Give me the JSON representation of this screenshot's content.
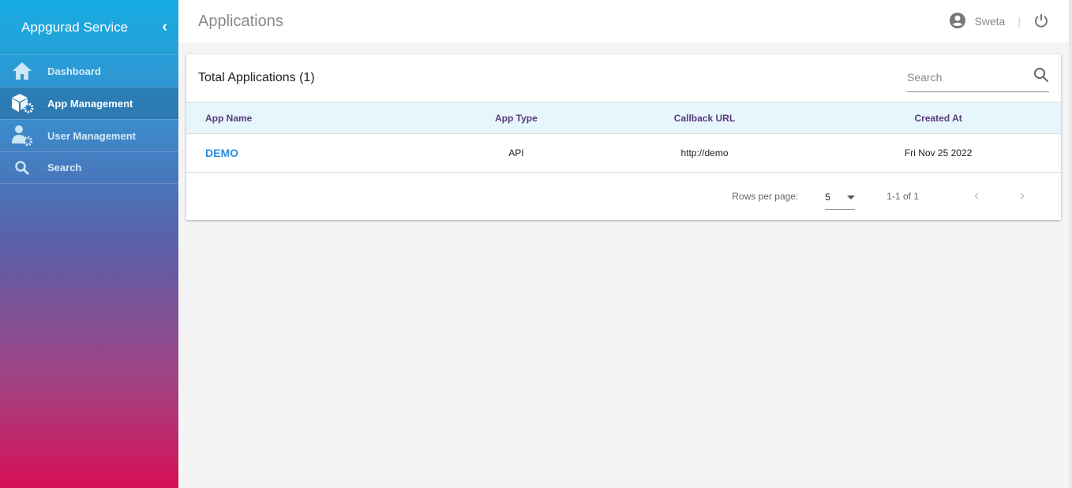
{
  "sidebar": {
    "brand": "Appgurad Service",
    "items": [
      {
        "label": "Dashboard",
        "icon": "home-icon"
      },
      {
        "label": "App Management",
        "icon": "app-settings-icon",
        "active": true
      },
      {
        "label": "User Management",
        "icon": "user-settings-icon"
      },
      {
        "label": "Search",
        "icon": "search-icon"
      }
    ]
  },
  "header": {
    "title": "Applications",
    "user": "Sweta",
    "separator": "|"
  },
  "card": {
    "title": "Total Applications",
    "count": "(1)",
    "search_placeholder": "Search",
    "columns": [
      "App Name",
      "App Type",
      "Callback URL",
      "Created At"
    ],
    "rows": [
      {
        "name": "DEMO",
        "type": "API",
        "url": "http://demo",
        "created": "Fri Nov 25 2022"
      }
    ],
    "footer": {
      "rows_per_page_label": "Rows per page:",
      "rows_per_page": "5",
      "range": "1-1 of 1"
    }
  },
  "colors": {
    "accent": "#2a8ee0",
    "header_text": "#5a3a7a"
  }
}
